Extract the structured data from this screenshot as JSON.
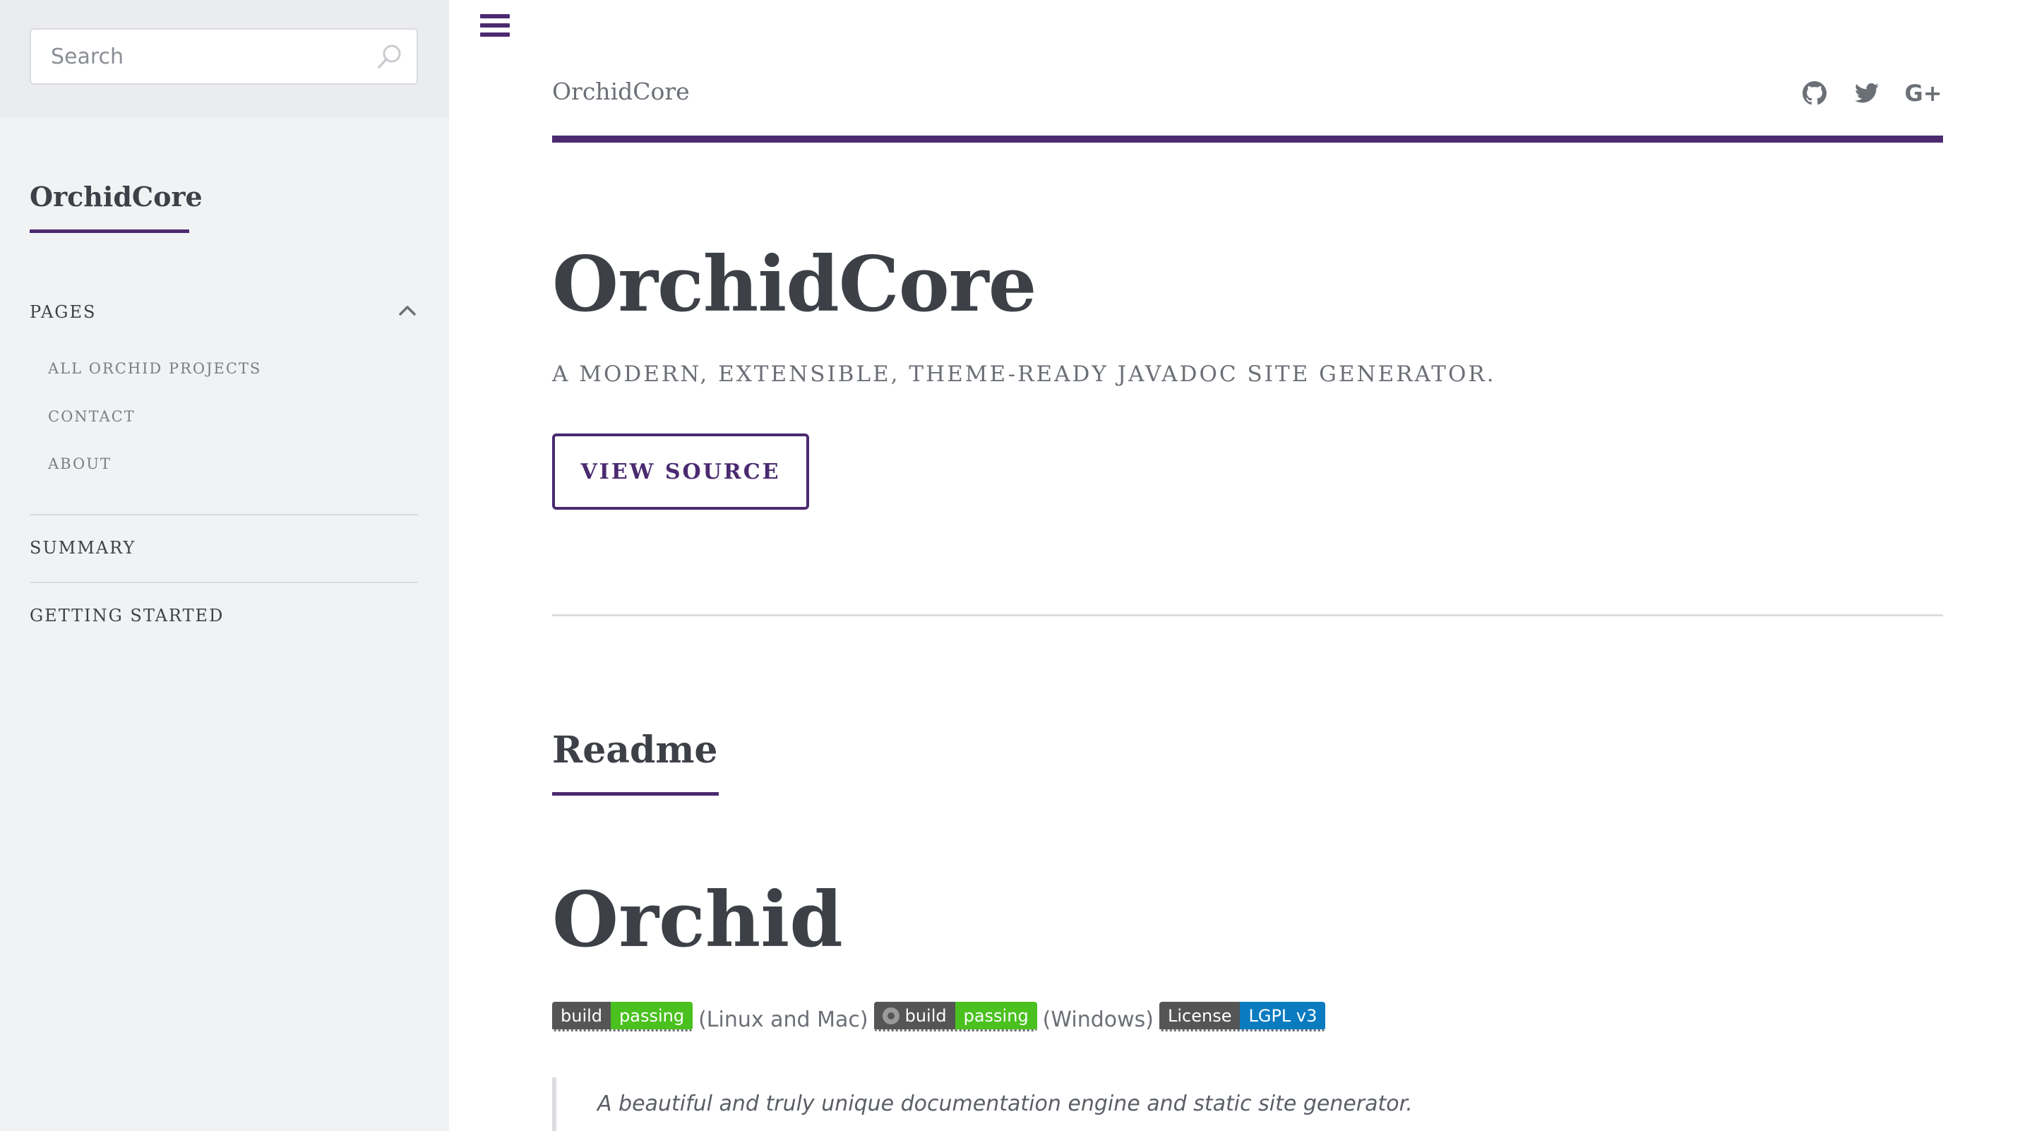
{
  "sidebar": {
    "search": {
      "placeholder": "Search"
    },
    "brand": "OrchidCore",
    "sections": [
      {
        "label": "PAGES",
        "expanded": true,
        "items": [
          "ALL ORCHID PROJECTS",
          "CONTACT",
          "ABOUT"
        ]
      },
      {
        "label": "SUMMARY"
      },
      {
        "label": "GETTING STARTED"
      }
    ]
  },
  "header": {
    "title": "OrchidCore",
    "icons": [
      "github-icon",
      "twitter-icon",
      "google-plus-icon"
    ],
    "gplus_label": "G+"
  },
  "hero": {
    "title": "OrchidCore",
    "subtitle": "A MODERN, EXTENSIBLE, THEME-READY JAVADOC SITE GENERATOR.",
    "button": "VIEW SOURCE"
  },
  "readme": {
    "heading": "Readme",
    "title": "Orchid",
    "badges": [
      {
        "left": "build",
        "right": "passing",
        "after": "(Linux and Mac)"
      },
      {
        "left": "build",
        "right": "passing",
        "after": "(Windows)"
      },
      {
        "left": "License",
        "right": "LGPL v3"
      }
    ],
    "quote": "A beautiful and truly unique documentation engine and static site generator."
  },
  "colors": {
    "accent": "#4b2a70",
    "text": "#3d4147",
    "muted": "#6b6f76",
    "sidebar_bg": "#f1f2f4",
    "badge_green": "#4ac11f",
    "badge_blue": "#0b7bc0"
  }
}
